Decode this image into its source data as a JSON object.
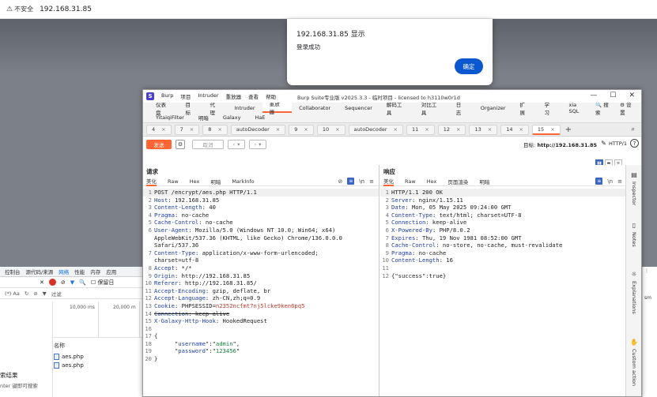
{
  "browser": {
    "security_label": "不安全",
    "url": "192.168.31.85"
  },
  "alert": {
    "title": "192.168.31.85 显示",
    "message": "登录成功",
    "ok_label": "确定"
  },
  "devtools": {
    "tabs": [
      "控制台",
      "源代码/来源",
      "网络",
      "性能",
      "内存",
      "应用"
    ],
    "active_tab": "网络",
    "preserve_log": "保留日",
    "filter_placeholder": "过滤",
    "timeline": [
      "10,000 ms",
      "20,000 m"
    ],
    "name_header": "名称",
    "requests": [
      "aes.php",
      "aes.php"
    ],
    "search_results_title": "索结果",
    "search_hint": "nter 键即可搜索"
  },
  "burp": {
    "menu": [
      "Burp",
      "项目",
      "Intruder",
      "重放器",
      "查看",
      "帮助"
    ],
    "title": "Burp Suite专业版 v2025.3.3 - 临时项目 - licensed to h3110w0r1d",
    "main_tabs": [
      "仪表盘",
      "目标",
      "代理",
      "Intruder",
      "重放器",
      "Collaborator",
      "Sequencer",
      "解码工具",
      "对比工具",
      "日志",
      "Organizer",
      "扩展",
      "学习",
      "xia SQL"
    ],
    "active_main_tab": "重放器",
    "search_label": "搜索",
    "settings_label": "设置",
    "ext_tabs": [
      "YitaiqiFilter",
      "明暗",
      "Galaxy",
      "HaE"
    ],
    "repeater_tabs": [
      {
        "label": "4",
        "active": false
      },
      {
        "label": "7",
        "active": false
      },
      {
        "label": "8",
        "active": false
      },
      {
        "label": "autoDecoder",
        "active": false
      },
      {
        "label": "9",
        "active": false
      },
      {
        "label": "10",
        "active": false
      },
      {
        "label": "autoDecoder",
        "active": false
      },
      {
        "label": "11",
        "active": false
      },
      {
        "label": "12",
        "active": false
      },
      {
        "label": "13",
        "active": false
      },
      {
        "label": "14",
        "active": false
      },
      {
        "label": "15",
        "active": true
      }
    ],
    "send_label": "发送",
    "cancel_label": "取消",
    "target_label": "目标:",
    "target_value": "http://192.168.31.85",
    "http_version": "HTTP/1",
    "request": {
      "heading": "请求",
      "tabs": [
        "美化",
        "Raw",
        "Hex",
        "明暗",
        "MarkInfo"
      ],
      "lines": [
        {
          "k": "",
          "v": "POST /encrypt/aes.php HTTP/1.1"
        },
        {
          "k": "Host",
          "v": " 192.168.31.85"
        },
        {
          "k": "Content-Length",
          "v": " 40"
        },
        {
          "k": "Pragma",
          "v": " no-cache"
        },
        {
          "k": "Cache-Control",
          "v": " no-cache"
        },
        {
          "k": "User-Agent",
          "v": " Mozilla/5.0 (Windows NT 10.0; Win64; x64)"
        },
        {
          "k": "",
          "v": "AppleWebKit/537.36 (KHTML, like Gecko) Chrome/136.0.0.0",
          "cont": true
        },
        {
          "k": "",
          "v": "Safari/537.36",
          "cont": true
        },
        {
          "k": "Content-Type",
          "v": " application/x-www-form-urlencoded;"
        },
        {
          "k": "",
          "v": "charset=utf-8",
          "cont": true
        },
        {
          "k": "Accept",
          "v": " */*"
        },
        {
          "k": "Origin",
          "v": " http://192.168.31.85"
        },
        {
          "k": "Referer",
          "v": " http://192.168.31.85/"
        },
        {
          "k": "Accept-Encoding",
          "v": " gzip, deflate, br"
        },
        {
          "k": "Accept-Language",
          "v": " zh-CN,zh;q=0.9"
        },
        {
          "k": "Cookie",
          "v": " PHPSESSID=",
          "red": "n2352ncfmt7nj5lcke9ken6pq5"
        },
        {
          "k": "Connection",
          "v": " keep-alive",
          "strike": true
        },
        {
          "k": "X-Galaxy-Http-Hook",
          "v": " HookedRequest"
        },
        {
          "k": "",
          "v": ""
        },
        {
          "k": "",
          "v": "{"
        },
        {
          "k": "",
          "v": "",
          "json_key": "username",
          "json_val": "admin",
          "comma": true
        },
        {
          "k": "",
          "v": "",
          "json_key": "password",
          "json_val": "123456",
          "comma": false
        },
        {
          "k": "",
          "v": "}"
        }
      ]
    },
    "response": {
      "heading": "响应",
      "tabs": [
        "美化",
        "Raw",
        "Hex",
        "页面渲染",
        "明暗"
      ],
      "lines": [
        {
          "k": "",
          "v": "HTTP/1.1 200 OK"
        },
        {
          "k": "Server",
          "v": " nginx/1.15.11"
        },
        {
          "k": "Date",
          "v": " Mon, 05 May 2025 09:24:00 GMT"
        },
        {
          "k": "Content-Type",
          "v": " text/html; charset=UTF-8"
        },
        {
          "k": "Connection",
          "v": " keep-alive"
        },
        {
          "k": "X-Powered-By",
          "v": " PHP/8.0.2"
        },
        {
          "k": "Expires",
          "v": " Thu, 19 Nov 1981 08:52:00 GMT"
        },
        {
          "k": "Cache-Control",
          "v": " no-store, no-cache, must-revalidate"
        },
        {
          "k": "Pragma",
          "v": " no-cache"
        },
        {
          "k": "Content-Length",
          "v": " 16"
        },
        {
          "k": "",
          "v": ""
        },
        {
          "k": "",
          "v": "{\"success\":true}"
        }
      ]
    },
    "side_panels": [
      "Inspector",
      "Notes",
      "Explanations",
      "Custom action"
    ]
  }
}
